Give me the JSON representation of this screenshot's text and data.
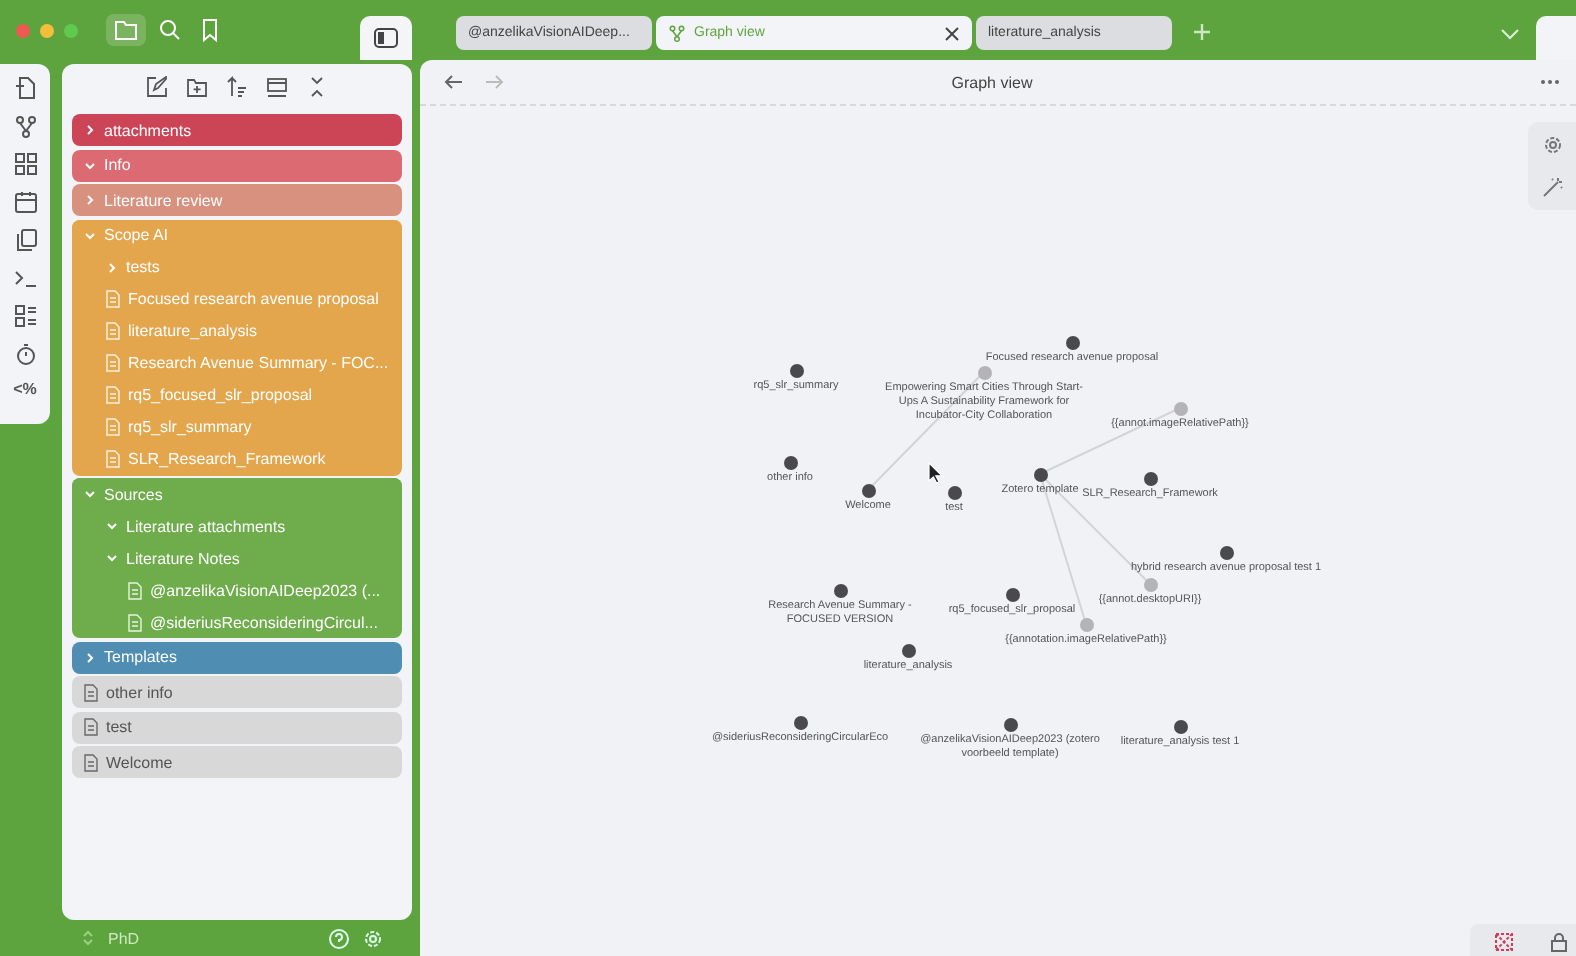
{
  "tabs": [
    {
      "label": "@anzelikaVisionAIDeep...",
      "selected": false
    },
    {
      "label": "Graph view",
      "selected": true
    },
    {
      "label": "literature_analysis",
      "selected": false
    }
  ],
  "ribbon": {
    "template_glyph": "<%"
  },
  "file_tree": [
    {
      "kind": "folder",
      "name": "attachments",
      "color": "#cc4557",
      "expanded": false
    },
    {
      "kind": "folder",
      "name": "Info",
      "color": "#db6a72",
      "expanded": true
    },
    {
      "kind": "folder",
      "name": "Literature review",
      "color": "#d8917f",
      "expanded": false
    },
    {
      "kind": "folder",
      "name": "Scope AI",
      "color": "#e3a64d",
      "expanded": true,
      "children": [
        {
          "kind": "folder",
          "name": "tests",
          "expanded": false
        },
        {
          "kind": "file",
          "name": "Focused research avenue proposal"
        },
        {
          "kind": "file",
          "name": "literature_analysis"
        },
        {
          "kind": "file",
          "name": "Research Avenue Summary - FOC..."
        },
        {
          "kind": "file",
          "name": "rq5_focused_slr_proposal"
        },
        {
          "kind": "file",
          "name": "rq5_slr_summary"
        },
        {
          "kind": "file",
          "name": "SLR_Research_Framework"
        }
      ]
    },
    {
      "kind": "folder",
      "name": "Sources",
      "color": "#6eac4c",
      "expanded": true,
      "children": [
        {
          "kind": "folder",
          "name": "Literature attachments",
          "expanded": true
        },
        {
          "kind": "folder",
          "name": "Literature Notes",
          "expanded": true,
          "children": [
            {
              "kind": "file",
              "name": "@anzelikaVisionAIDeep2023 (..."
            },
            {
              "kind": "file",
              "name": "@sideriusReconsideringCircul..."
            }
          ]
        }
      ]
    },
    {
      "kind": "folder",
      "name": "Templates",
      "color": "#4f8db3",
      "expanded": false
    },
    {
      "kind": "file",
      "name": "other info"
    },
    {
      "kind": "file",
      "name": "test"
    },
    {
      "kind": "file",
      "name": "Welcome"
    }
  ],
  "vault": {
    "name": "PhD"
  },
  "view": {
    "title": "Graph view"
  },
  "graph": {
    "nodes": [
      {
        "label": "Focused research avenue proposal",
        "kind": "note"
      },
      {
        "label": "rq5_slr_summary",
        "kind": "note"
      },
      {
        "label": "Empowering Smart Cities Through Start-Ups A Sustainability Framework for Incubator-City Collaboration",
        "kind": "unresolved"
      },
      {
        "label": "{{annot.imageRelativePath}}",
        "kind": "unresolved"
      },
      {
        "label": "other info",
        "kind": "note"
      },
      {
        "label": "Welcome",
        "kind": "note"
      },
      {
        "label": "test",
        "kind": "note"
      },
      {
        "label": "Zotero template",
        "kind": "note"
      },
      {
        "label": "SLR_Research_Framework",
        "kind": "note"
      },
      {
        "label": "hybrid research avenue proposal test 1",
        "kind": "note"
      },
      {
        "label": "{{annot.desktopURI}}",
        "kind": "unresolved"
      },
      {
        "label": "Research Avenue Summary - FOCUSED VERSION",
        "kind": "note"
      },
      {
        "label": "rq5_focused_slr_proposal",
        "kind": "note"
      },
      {
        "label": "{{annotation.imageRelativePath}}",
        "kind": "unresolved"
      },
      {
        "label": "literature_analysis",
        "kind": "note"
      },
      {
        "label": "@sideriusReconsideringCircularEco",
        "kind": "note"
      },
      {
        "label": "@anzelikaVisionAIDeep2023 (zotero voorbeeld template)",
        "kind": "note"
      },
      {
        "label": "literature_analysis test 1",
        "kind": "note"
      }
    ]
  }
}
